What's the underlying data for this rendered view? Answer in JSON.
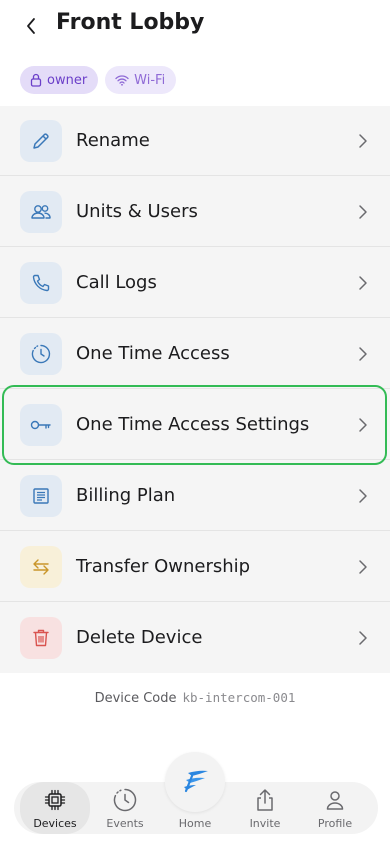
{
  "header": {
    "title": "Front Lobby"
  },
  "chips": [
    {
      "label": "owner",
      "icon": "lock-icon"
    },
    {
      "label": "Wi-Fi",
      "icon": "wifi-icon"
    }
  ],
  "menu": {
    "items": [
      {
        "label": "Rename",
        "icon": "pencil-icon"
      },
      {
        "label": "Units & Users",
        "icon": "users-icon"
      },
      {
        "label": "Call Logs",
        "icon": "phone-icon"
      },
      {
        "label": "One Time Access",
        "icon": "clock-icon"
      },
      {
        "label": "One Time Access Settings",
        "icon": "key-icon",
        "highlighted": true
      },
      {
        "label": "Billing Plan",
        "icon": "receipt-icon"
      },
      {
        "label": "Transfer Ownership",
        "icon": "transfer-arrows-icon"
      },
      {
        "label": "Delete Device",
        "icon": "trash-icon"
      }
    ]
  },
  "device_code": {
    "label": "Device Code",
    "value": "kb-intercom-001"
  },
  "tabbar": {
    "tabs": [
      {
        "label": "Devices",
        "icon": "chip-icon",
        "active": true
      },
      {
        "label": "Events",
        "icon": "clock-icon"
      },
      {
        "label": "Home",
        "icon": "logo-icon"
      },
      {
        "label": "Invite",
        "icon": "share-icon"
      },
      {
        "label": "Profile",
        "icon": "person-icon"
      }
    ]
  },
  "colors": {
    "accent": "#33bb55",
    "icon_blue": "#3a78b8",
    "icon_yellow": "#c9962a",
    "icon_red": "#d9534f",
    "chip_purple": "#6b3fc9"
  }
}
